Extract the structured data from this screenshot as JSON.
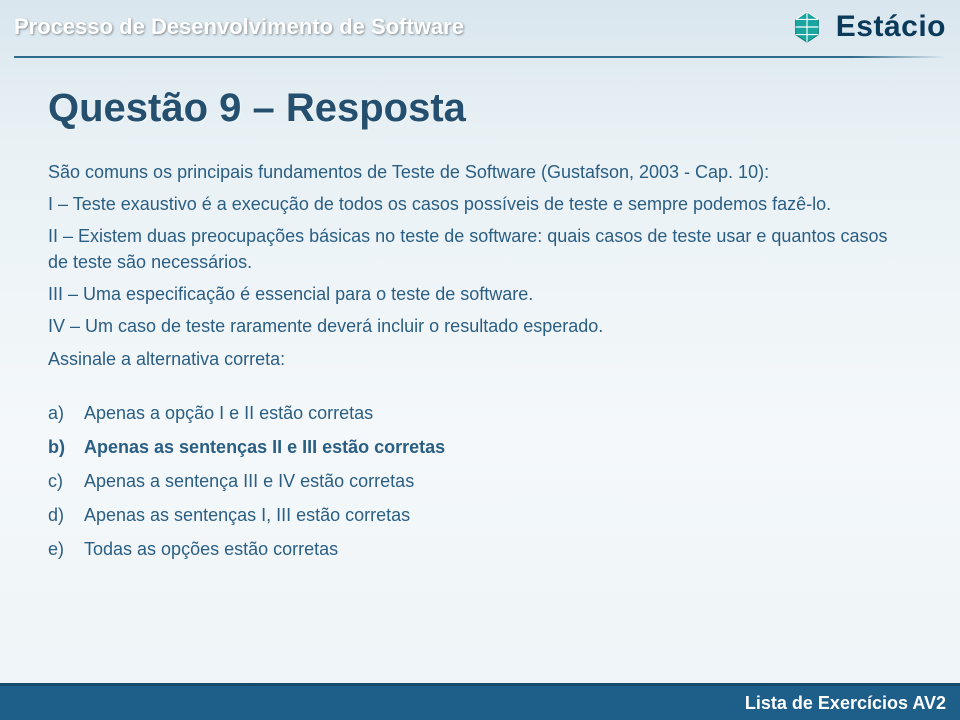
{
  "header": {
    "course_title": "Processo de Desenvolvimento de Software",
    "brand_name": "Estácio"
  },
  "question": {
    "title": "Questão 9 – Resposta",
    "intro": "São comuns os principais fundamentos de Teste de Software (Gustafson, 2003 - Cap. 10):",
    "stmt1": "I – Teste exaustivo é a execução de todos os casos possíveis de teste e sempre podemos fazê-lo.",
    "stmt2": "II – Existem duas preocupações básicas no teste de software: quais casos de teste usar e quantos casos de teste são necessários.",
    "stmt3": "III – Uma especificação é essencial para o teste de software.",
    "stmt4": "IV – Um caso de teste raramente deverá incluir o resultado esperado.",
    "prompt": "Assinale a alternativa correta:"
  },
  "options": {
    "a": {
      "letter": "a)",
      "text": "Apenas a opção I e II estão corretas"
    },
    "b": {
      "letter": "b)",
      "text": "Apenas as sentenças II e III estão corretas"
    },
    "c": {
      "letter": "c)",
      "text": "Apenas a sentença III e IV estão corretas"
    },
    "d": {
      "letter": "d)",
      "text": "Apenas as sentenças I, III estão corretas"
    },
    "e": {
      "letter": "e)",
      "text": "Todas as opções estão corretas"
    }
  },
  "correct_option": "b",
  "footer": {
    "text": "Lista de Exercícios AV2"
  },
  "colors": {
    "brand_teal": "#1aa5a0",
    "brand_dark": "#0a3a5a",
    "text_blue": "#2a5e83",
    "footer_bg": "#1e5f8a"
  }
}
